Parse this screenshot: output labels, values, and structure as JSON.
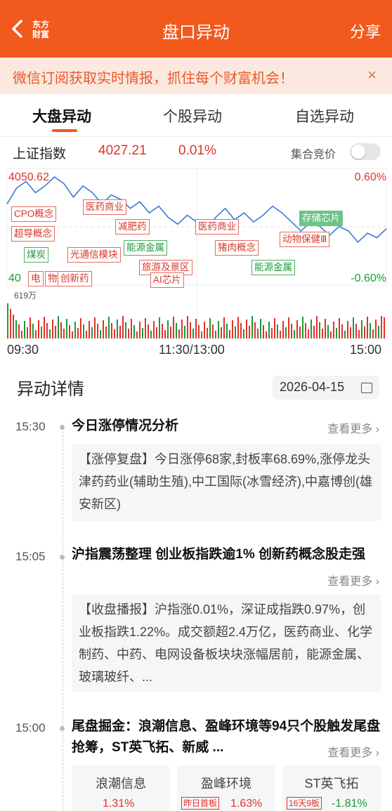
{
  "header": {
    "logo_line1": "东方",
    "logo_line2": "财富",
    "title": "盘口异动",
    "share": "分享"
  },
  "banner": {
    "text": "微信订阅获取实时情报，抓住每个财富机会！",
    "close": "×"
  },
  "tabs": [
    {
      "label": "大盘异动",
      "active": true
    },
    {
      "label": "个股异动",
      "active": false
    },
    {
      "label": "自选异动",
      "active": false
    }
  ],
  "index": {
    "name": "上证指数",
    "value": "4027.21",
    "change": "0.01%",
    "auction_label": "集合竞价",
    "auction_on": false
  },
  "chart": {
    "y_top_label": "4050.62",
    "y_right_top": "0.60%",
    "y_right_bottom": "-0.60%",
    "y_bottom_label": "40",
    "vol_label": "619万",
    "time_labels": [
      "09:30",
      "11:30/13:00",
      "15:00"
    ],
    "tags": [
      "CPO概念",
      "超导概念",
      "煤炭",
      "电",
      "物",
      "创新药",
      "光通信模块",
      "医药商业",
      "减肥药",
      "能源金属",
      "旅游及景区",
      "AI芯片",
      "医药商业",
      "猪肉概念",
      "能源金属",
      "动物保健Ⅲ",
      "存储芯片"
    ],
    "colors": {
      "price": "#3a7bd5",
      "up": "#e5312a",
      "down": "#1c9a3a"
    }
  },
  "chart_data": {
    "type": "line",
    "title": "上证指数",
    "x": [
      "09:30",
      "11:30/13:00",
      "15:00"
    ],
    "ylim": [
      4003.8,
      4050.62
    ],
    "series": [
      {
        "values": [
          4038,
          4045,
          4048,
          4043,
          4046,
          4050,
          4047,
          4041,
          4046,
          4043,
          4038,
          4042,
          4040,
          4036,
          4039,
          4034,
          4037,
          4032,
          4029,
          4033,
          4030,
          4027,
          4032,
          4036,
          4031,
          4034,
          4030,
          4033,
          4037,
          4034,
          4030,
          4026,
          4030,
          4028,
          4024,
          4028,
          4026,
          4021,
          4025,
          4023,
          4027
        ]
      }
    ]
  },
  "section": {
    "title": "异动详情",
    "date": "2026-04-15"
  },
  "events": [
    {
      "time": "15:30",
      "title": "今日涨停情况分析",
      "more": "查看更多 ›",
      "body": "【涨停复盘】今日涨停68家,封板率68.69%,涨停龙头津药药业(辅助生殖),中工国际(冰雪经济),中嘉博创(雄安新区)"
    },
    {
      "time": "15:05",
      "title": "沪指震荡整理 创业板指跌逾1% 创新药概念股走强",
      "more": "查看更多 ›",
      "body": "【收盘播报】沪指涨0.01%，深证成指跌0.97%，创业板指跌1.22%。成交额超2.4万亿，医药商业、化学制药、中药、电网设备板块块涨幅居前，能源金属、玻璃玻纤、..."
    },
    {
      "time": "15:00",
      "title": "尾盘掘金：浪潮信息、盈峰环境等94只个股触发尾盘抢筹，ST英飞拓、新威 ...",
      "more": "查看更多 ›"
    }
  ],
  "stocks": [
    {
      "name": "浪潮信息",
      "pct": "1.31%",
      "badge": ""
    },
    {
      "name": "盈峰环境",
      "pct": "1.63%",
      "badge": "昨日首板"
    },
    {
      "name": "ST英飞拓",
      "pct": "-1.81%",
      "badge": "16天9板"
    }
  ]
}
